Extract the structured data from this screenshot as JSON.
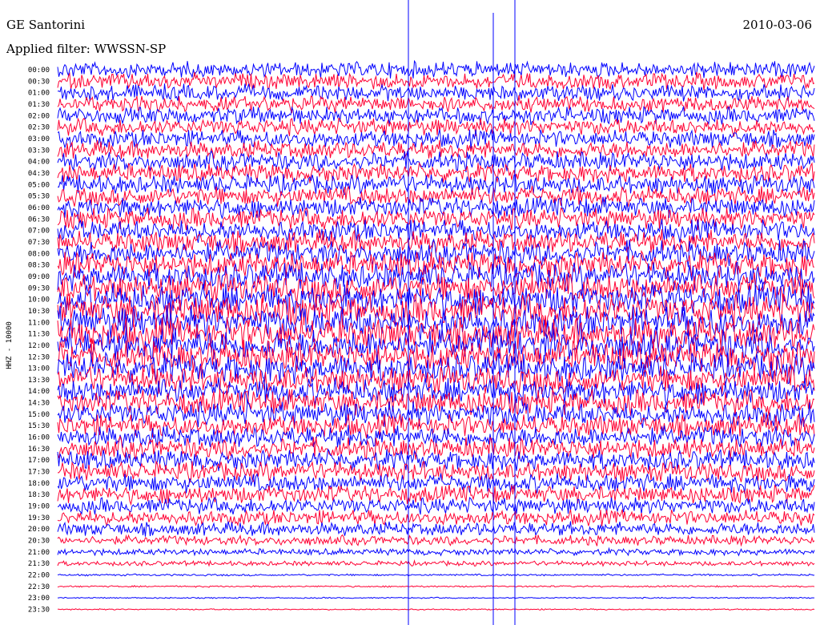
{
  "header": {
    "station": "GE Santorini",
    "filter": "Applied filter: WWSSN-SP",
    "date": "2010-03-06"
  },
  "chart_data": {
    "type": "line",
    "ylabel": "HHZ - 10000",
    "colors": [
      "#0000ff",
      "#ff0033"
    ],
    "row_labels": [
      "00:00",
      "00:30",
      "01:00",
      "01:30",
      "02:00",
      "02:30",
      "03:00",
      "03:30",
      "04:00",
      "04:30",
      "05:00",
      "05:30",
      "06:00",
      "06:30",
      "07:00",
      "07:30",
      "08:00",
      "08:30",
      "09:00",
      "09:30",
      "10:00",
      "10:30",
      "11:00",
      "11:30",
      "12:00",
      "12:30",
      "13:00",
      "13:30",
      "14:00",
      "14:30",
      "15:00",
      "15:30",
      "16:00",
      "16:30",
      "17:00",
      "17:30",
      "18:00",
      "18:30",
      "19:00",
      "19:30",
      "20:00",
      "20:30",
      "21:00",
      "21:30",
      "22:00",
      "22:30",
      "23:00",
      "23:30"
    ],
    "noise_level": [
      1.0,
      1.0,
      1.0,
      1.0,
      1.05,
      1.05,
      1.1,
      1.1,
      1.15,
      1.15,
      1.2,
      1.2,
      1.25,
      1.3,
      1.35,
      1.4,
      1.5,
      1.6,
      1.7,
      1.8,
      1.9,
      2.0,
      2.0,
      2.0,
      2.0,
      1.9,
      1.8,
      1.7,
      1.6,
      1.55,
      1.5,
      1.4,
      1.35,
      1.3,
      1.25,
      1.2,
      1.15,
      1.1,
      1.0,
      0.95,
      0.85,
      0.6,
      0.4,
      0.3,
      0.12,
      0.1,
      0.08,
      0.08
    ]
  }
}
